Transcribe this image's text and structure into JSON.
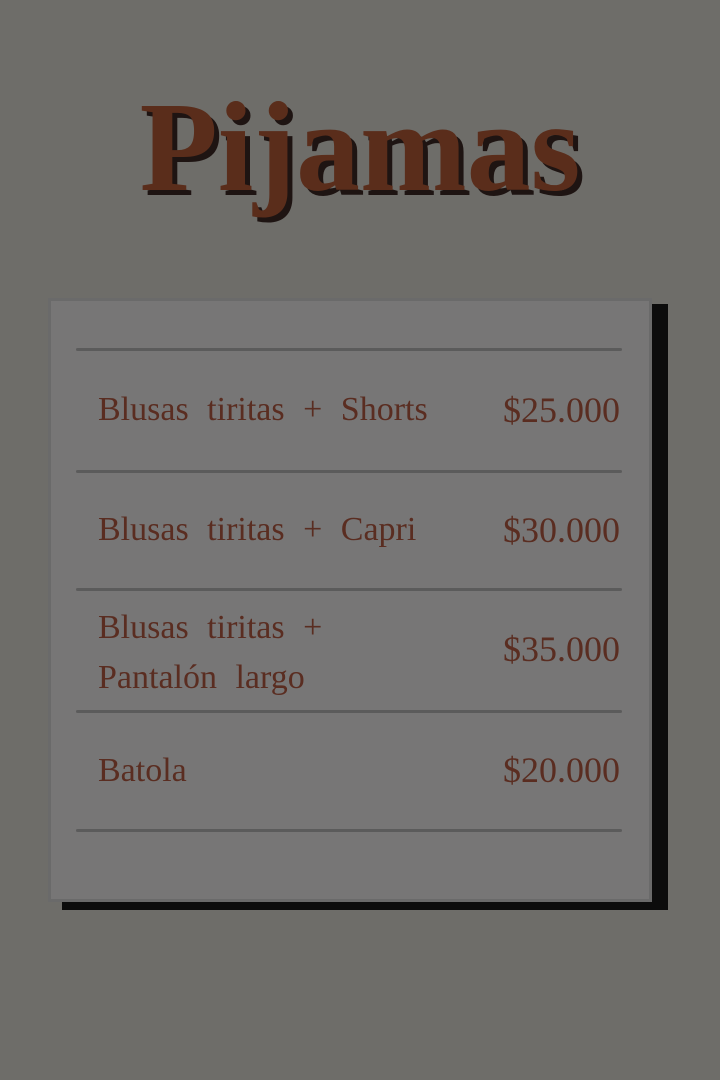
{
  "title": "Pijamas",
  "items": [
    {
      "name": "Blusas tiritas + Shorts",
      "price": "$25.000"
    },
    {
      "name": "Blusas tiritas + Capri",
      "price": "$30.000"
    },
    {
      "name": "Blusas tiritas +\nPantalón largo",
      "price": "$35.000"
    },
    {
      "name": "Batola",
      "price": "$20.000"
    }
  ],
  "colors": {
    "background": "#6e6d69",
    "card": "#777676",
    "text": "#5a2d21",
    "title": "#5a2d1b"
  }
}
